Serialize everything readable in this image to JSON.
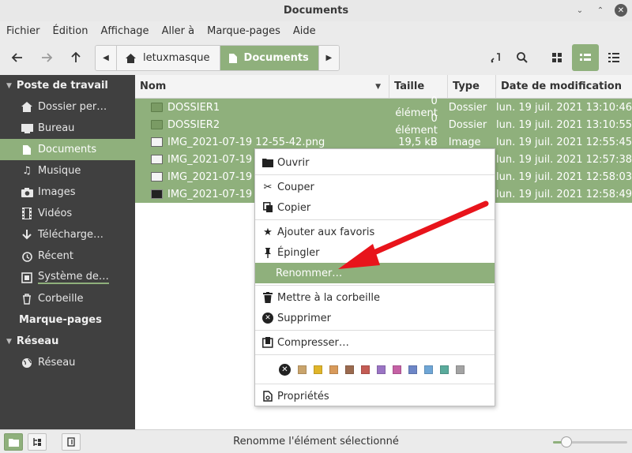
{
  "window": {
    "title": "Documents",
    "controls": {
      "minimize_icon": "minimize-icon",
      "maximize_icon": "maximize-icon",
      "close_icon": "close-icon"
    }
  },
  "menubar": [
    "Fichier",
    "Édition",
    "Affichage",
    "Aller à",
    "Marque-pages",
    "Aide"
  ],
  "toolbar": {
    "back_icon": "arrow-left-icon",
    "forward_icon": "arrow-right-icon",
    "up_icon": "arrow-up-icon",
    "path": [
      {
        "label": "letuxmasque",
        "icon": "home-icon",
        "active": false
      },
      {
        "label": "Documents",
        "icon": "document-icon",
        "active": true
      }
    ],
    "right_icons": [
      "open-terminal-icon",
      "search-icon",
      "icon-view-icon",
      "list-view-icon",
      "compact-view-icon"
    ],
    "active_view": "list-view-icon"
  },
  "sidebar": {
    "sections": [
      {
        "header": "Poste de travail",
        "collapsible": true,
        "items": [
          {
            "label": "Dossier per…",
            "icon": "home-icon"
          },
          {
            "label": "Bureau",
            "icon": "desktop-icon"
          },
          {
            "label": "Documents",
            "icon": "document-icon",
            "active": true
          },
          {
            "label": "Musique",
            "icon": "music-icon"
          },
          {
            "label": "Images",
            "icon": "camera-icon"
          },
          {
            "label": "Vidéos",
            "icon": "film-icon"
          },
          {
            "label": "Télécharge…",
            "icon": "download-icon"
          },
          {
            "label": "Récent",
            "icon": "history-icon"
          },
          {
            "label": "Système de…",
            "icon": "drive-icon",
            "usage_bar": true
          },
          {
            "label": "Corbeille",
            "icon": "trash-icon"
          }
        ]
      },
      {
        "header": "Marque-pages",
        "collapsible": false,
        "items": []
      },
      {
        "header": "Réseau",
        "collapsible": true,
        "items": [
          {
            "label": "Réseau",
            "icon": "network-icon"
          }
        ]
      }
    ]
  },
  "file_list": {
    "columns": {
      "name": "Nom",
      "size": "Taille",
      "type": "Type",
      "date": "Date de modification"
    },
    "rows": [
      {
        "name": "DOSSIER1",
        "size": "0 élément",
        "type": "Dossier",
        "date": "lun. 19 juil. 2021 13:10:46",
        "icon": "folder-icon"
      },
      {
        "name": "DOSSIER2",
        "size": "0 élément",
        "type": "Dossier",
        "date": "lun. 19 juil. 2021 13:10:55",
        "icon": "folder-icon"
      },
      {
        "name": "IMG_2021-07-19 12-55-42.png",
        "size": "19,5 kB",
        "type": "Image",
        "date": "lun. 19 juil. 2021 12:55:45",
        "icon": "image-icon"
      },
      {
        "name": "IMG_2021-07-19 1",
        "size": "",
        "type": "",
        "date": "lun. 19 juil. 2021 12:57:38",
        "icon": "image-icon"
      },
      {
        "name": "IMG_2021-07-19 1",
        "size": "",
        "type": "",
        "date": "lun. 19 juil. 2021 12:58:03",
        "icon": "image-icon"
      },
      {
        "name": "IMG_2021-07-19 1",
        "size": "",
        "type": "",
        "date": "lun. 19 juil. 2021 12:58:49",
        "icon": "image-dark-icon"
      }
    ]
  },
  "context_menu": {
    "groups": [
      [
        {
          "label": "Ouvrir",
          "icon": "folder-open-icon"
        }
      ],
      [
        {
          "label": "Couper",
          "icon": "scissors-icon"
        },
        {
          "label": "Copier",
          "icon": "copy-icon"
        }
      ],
      [
        {
          "label": "Ajouter aux favoris",
          "icon": "star-add-icon"
        },
        {
          "label": "Épingler",
          "icon": "pin-icon"
        },
        {
          "label": "Renommer…",
          "icon": "",
          "highlighted": true
        }
      ],
      [
        {
          "label": "Mettre à la corbeille",
          "icon": "trash-icon"
        },
        {
          "label": "Supprimer",
          "icon": "delete-icon"
        }
      ],
      [
        {
          "label": "Compresser…",
          "icon": "archive-icon"
        }
      ]
    ],
    "tag_colors": [
      "#c9a46c",
      "#e0b52a",
      "#d89a5b",
      "#9b6a4f",
      "#c45c55",
      "#9a74c4",
      "#c561a5",
      "#6d86c7",
      "#6fa6d6",
      "#5aab9c",
      "#a3a3a3"
    ],
    "properties": {
      "label": "Propriétés",
      "icon": "properties-icon"
    }
  },
  "annotation_arrow": {
    "color": "#e8141b"
  },
  "statusbar": {
    "text": "Renomme l'élément sélectionné",
    "buttons": [
      "places-icon",
      "tree-icon",
      "hide-sidebar-icon"
    ],
    "zoom_level": 0.12
  },
  "colors": {
    "accent": "#8fb07c",
    "sidebar_bg": "#404040"
  }
}
